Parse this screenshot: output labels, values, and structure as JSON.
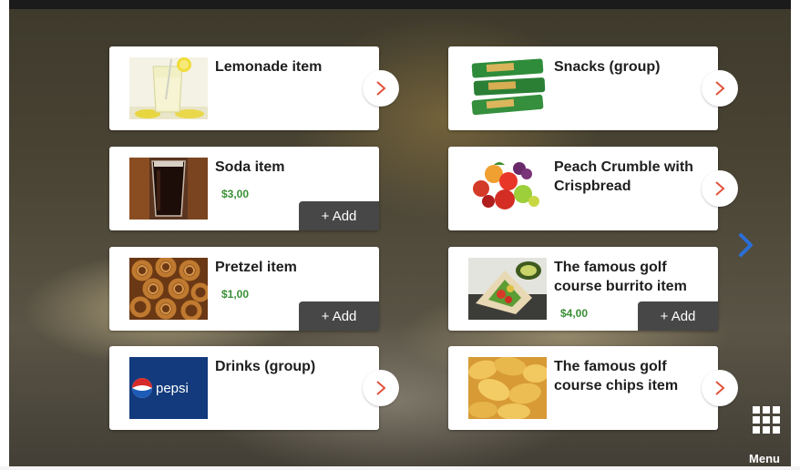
{
  "items": [
    {
      "title": "Lemonade item",
      "price": "",
      "add_label": "",
      "thumb_icon": "lemonade-image"
    },
    {
      "title": "Snacks (group)",
      "price": "",
      "add_label": "",
      "thumb_icon": "snack-bars-image"
    },
    {
      "title": "Soda item",
      "price": "$3,00",
      "add_label": "+ Add",
      "thumb_icon": "soda-glass-image"
    },
    {
      "title": "Peach Crumble with Crispbread",
      "price": "",
      "add_label": "",
      "thumb_icon": "fruit-image"
    },
    {
      "title": "Pretzel item",
      "price": "$1,00",
      "add_label": "+ Add",
      "thumb_icon": "pretzels-image"
    },
    {
      "title": "The famous golf course burrito item",
      "price": "$4,00",
      "add_label": "+ Add",
      "thumb_icon": "burrito-image"
    },
    {
      "title": "Drinks (group)",
      "price": "",
      "add_label": "",
      "thumb_icon": "pepsi-logo-image",
      "logo_text": "pepsi"
    },
    {
      "title": "The famous golf course chips item",
      "price": "",
      "add_label": "",
      "thumb_icon": "chips-image"
    }
  ],
  "navigation": {
    "next_icon": "chevron-right-icon"
  },
  "menu": {
    "label": "Menu",
    "icon": "grid-menu-icon"
  },
  "colors": {
    "price": "#3a8f35",
    "add_button": "#474747",
    "chevron": "#e0533c",
    "next_arrow": "#2a6fd6"
  }
}
